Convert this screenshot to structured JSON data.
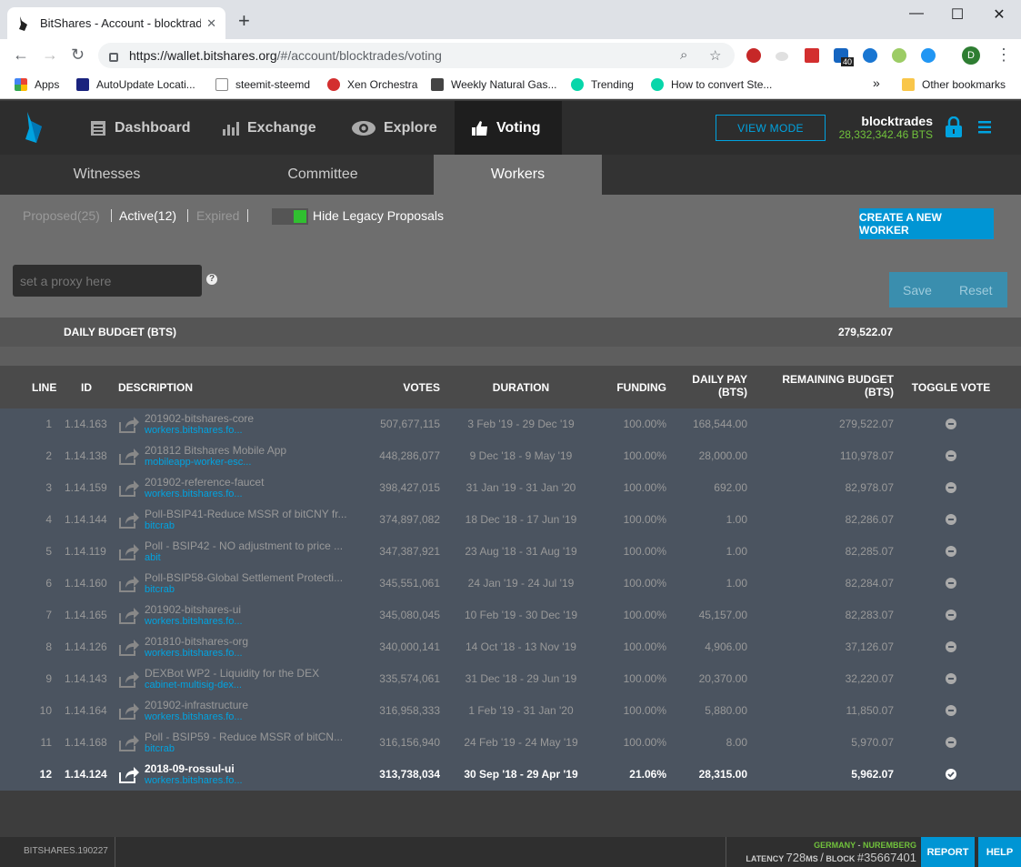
{
  "browser": {
    "tab_title": "BitShares - Account - blocktrades",
    "url_host": "https://wallet.bitshares.org",
    "url_path": "/#/account/blocktrades/voting",
    "extension_badge": "40",
    "profile_initial": "D"
  },
  "bookmarks": {
    "items": [
      {
        "label": "Apps",
        "color": "#ea4335"
      },
      {
        "label": "AutoUpdate Locati...",
        "color": "#1a237e"
      },
      {
        "label": "steemit-steemd",
        "color": "#ffffff"
      },
      {
        "label": "Xen Orchestra",
        "color": "#d32f2f"
      },
      {
        "label": "Weekly Natural Gas...",
        "color": "#444444"
      },
      {
        "label": "Trending",
        "color": "#07d6aa"
      },
      {
        "label": "How to convert Ste...",
        "color": "#07d6aa"
      }
    ],
    "overflow": "»",
    "other": "Other bookmarks"
  },
  "header": {
    "nav": [
      "Dashboard",
      "Exchange",
      "Explore",
      "Voting"
    ],
    "view_mode": "VIEW MODE",
    "account_name": "blocktrades",
    "account_balance": "28,332,342.46 BTS"
  },
  "subtabs": [
    "Witnesses",
    "Committee",
    "Workers"
  ],
  "filters": {
    "proposed": "Proposed(25)",
    "active": "Active(12)",
    "expired": "Expired",
    "hide_legacy": "Hide Legacy Proposals",
    "create_worker": "CREATE A NEW WORKER",
    "proxy_placeholder": "set a proxy here",
    "help": "?",
    "save": "Save",
    "reset": "Reset"
  },
  "budget": {
    "label": "DAILY BUDGET (BTS)",
    "value": "279,522.07"
  },
  "table": {
    "headers": {
      "line": "LINE",
      "id": "ID",
      "description": "DESCRIPTION",
      "votes": "VOTES",
      "duration": "DURATION",
      "funding": "FUNDING",
      "daily_pay_1": "DAILY PAY",
      "daily_pay_2": "(BTS)",
      "remaining_1": "REMAINING BUDGET",
      "remaining_2": "(BTS)",
      "toggle": "TOGGLE VOTE"
    },
    "rows": [
      {
        "line": "1",
        "id": "1.14.163",
        "title": "201902-bitshares-core",
        "link": "workers.bitshares.fo...",
        "votes": "507,677,115",
        "duration": "3 Feb '19 - 29 Dec '19",
        "funding": "100.00%",
        "daily": "168,544.00",
        "remaining": "279,522.07",
        "voted": false
      },
      {
        "line": "2",
        "id": "1.14.138",
        "title": "201812 Bitshares Mobile App",
        "link": "mobileapp-worker-esc...",
        "votes": "448,286,077",
        "duration": "9 Dec '18 - 9 May '19",
        "funding": "100.00%",
        "daily": "28,000.00",
        "remaining": "110,978.07",
        "voted": false
      },
      {
        "line": "3",
        "id": "1.14.159",
        "title": "201902-reference-faucet",
        "link": "workers.bitshares.fo...",
        "votes": "398,427,015",
        "duration": "31 Jan '19 - 31 Jan '20",
        "funding": "100.00%",
        "daily": "692.00",
        "remaining": "82,978.07",
        "voted": false
      },
      {
        "line": "4",
        "id": "1.14.144",
        "title": "Poll-BSIP41-Reduce MSSR of bitCNY fr...",
        "link": "bitcrab",
        "votes": "374,897,082",
        "duration": "18 Dec '18 - 17 Jun '19",
        "funding": "100.00%",
        "daily": "1.00",
        "remaining": "82,286.07",
        "voted": false
      },
      {
        "line": "5",
        "id": "1.14.119",
        "title": "Poll - BSIP42 - NO adjustment to price ...",
        "link": "abit",
        "votes": "347,387,921",
        "duration": "23 Aug '18 - 31 Aug '19",
        "funding": "100.00%",
        "daily": "1.00",
        "remaining": "82,285.07",
        "voted": false
      },
      {
        "line": "6",
        "id": "1.14.160",
        "title": "Poll-BSIP58-Global Settlement Protecti...",
        "link": "bitcrab",
        "votes": "345,551,061",
        "duration": "24 Jan '19 - 24 Jul '19",
        "funding": "100.00%",
        "daily": "1.00",
        "remaining": "82,284.07",
        "voted": false
      },
      {
        "line": "7",
        "id": "1.14.165",
        "title": "201902-bitshares-ui",
        "link": "workers.bitshares.fo...",
        "votes": "345,080,045",
        "duration": "10 Feb '19 - 30 Dec '19",
        "funding": "100.00%",
        "daily": "45,157.00",
        "remaining": "82,283.07",
        "voted": false
      },
      {
        "line": "8",
        "id": "1.14.126",
        "title": "201810-bitshares-org",
        "link": "workers.bitshares.fo...",
        "votes": "340,000,141",
        "duration": "14 Oct '18 - 13 Nov '19",
        "funding": "100.00%",
        "daily": "4,906.00",
        "remaining": "37,126.07",
        "voted": false
      },
      {
        "line": "9",
        "id": "1.14.143",
        "title": "DEXBot WP2 - Liquidity for the DEX",
        "link": "cabinet-multisig-dex...",
        "votes": "335,574,061",
        "duration": "31 Dec '18 - 29 Jun '19",
        "funding": "100.00%",
        "daily": "20,370.00",
        "remaining": "32,220.07",
        "voted": false
      },
      {
        "line": "10",
        "id": "1.14.164",
        "title": "201902-infrastructure",
        "link": "workers.bitshares.fo...",
        "votes": "316,958,333",
        "duration": "1 Feb '19 - 31 Jan '20",
        "funding": "100.00%",
        "daily": "5,880.00",
        "remaining": "11,850.07",
        "voted": false
      },
      {
        "line": "11",
        "id": "1.14.168",
        "title": "Poll - BSIP59 - Reduce MSSR of bitCN...",
        "link": "bitcrab",
        "votes": "316,156,940",
        "duration": "24 Feb '19 - 24 May '19",
        "funding": "100.00%",
        "daily": "8.00",
        "remaining": "5,970.07",
        "voted": false
      },
      {
        "line": "12",
        "id": "1.14.124",
        "title": "2018-09-rossul-ui",
        "link": "workers.bitshares.fo...",
        "votes": "313,738,034",
        "duration": "30 Sep '18 - 29 Apr '19",
        "funding": "21.06%",
        "daily": "28,315.00",
        "remaining": "5,962.07",
        "voted": true
      }
    ]
  },
  "footer": {
    "version": "BITSHARES.190227",
    "country": "GERMANY",
    "dash": "-",
    "city": "NUREMBERG",
    "latency_label": "LATENCY",
    "latency_value": "728",
    "latency_unit": "MS",
    "block_sep": "/",
    "block_label": "BLOCK",
    "block_value": "#35667401",
    "report": "REPORT",
    "help": "HELP"
  }
}
